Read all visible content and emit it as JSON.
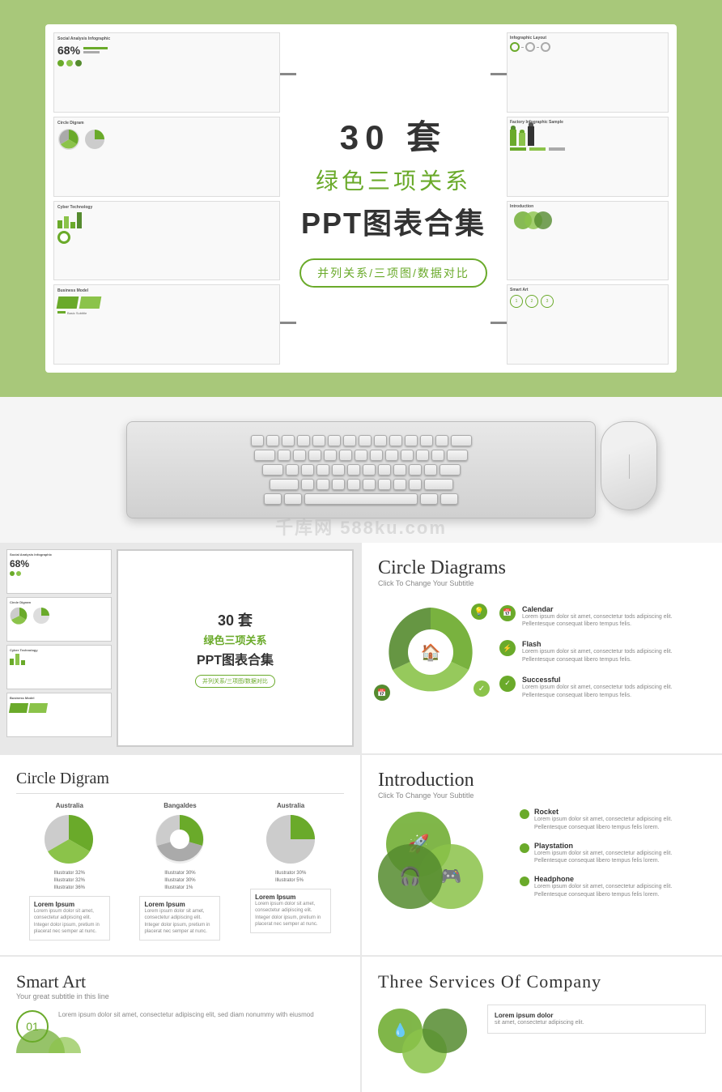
{
  "hero": {
    "title_num": "30 套",
    "title_zh": "绿色三项关系",
    "title_ppt": "PPT图表合集",
    "badge": "并列关系/三项图/数据对比",
    "frame_label": "center-frame"
  },
  "slides": {
    "slide1_label": "Social Analysis Infographic",
    "slide1_stat": "68%",
    "slide2_label": "Circle Digram",
    "slide3_label": "Cyber Technology",
    "slide4_label": "Business Model",
    "slide5_label": "Infographic Layout",
    "slide6_label": "Factory Infographic Sample",
    "slide7_label": "Introduction",
    "slide8_label": "Smart Art"
  },
  "circle_diagrams": {
    "title": "Circle Diagrams",
    "subtitle": "Click To Change Your Subtitle",
    "item1_title": "Calendar",
    "item1_desc": "Lorem ipsum dolor sit amet, consectetur tods adipiscing elit. Pellentesque consequat libero tempus felis.",
    "item2_title": "Flash",
    "item2_desc": "Lorem ipsum dolor sit amet, consectetur tods adipiscing elit. Pellentesque consequat libero tempus felis.",
    "item3_title": "Successful",
    "item3_desc": "Lorem ipsum dolor sit amet, consectetur tods adipiscing elit. Pellentesque consequat libero tempus felis."
  },
  "circle_digram": {
    "title": "Circle Digram",
    "country1": "Australia",
    "country2": "Bangaldes",
    "country3": "Australia",
    "legend1": [
      "Illustrator 32%",
      "Illustrator 32%",
      "Illustrator 36%"
    ],
    "legend2": [
      "Illustrator 30%",
      "Illustrator 30%",
      "Illustrator 1%"
    ],
    "legend3": [
      "Illustrator 30%",
      "Illustrator 5%"
    ],
    "box1_title": "Lorem Ipsum",
    "box1_desc": "Lorem ipsum dolor sit amet, consectetur adipiscing elit. Integer dolor ipsum, pretium in placerat nec semper at nunc.",
    "box2_title": "Lorem Ipsum",
    "box2_desc": "Lorem ipsum dolor sit amet, consectetur adipiscing elit. Integer dolor ipsum, pretium in placerat nec semper at nunc.",
    "box3_title": "Lorem Ipsum",
    "box3_desc": "Lorem ipsum dolor sit amet, consectetur adipiscing elit. Integer dolor ipsum, pretium in placerat nec semper at nunc."
  },
  "introduction": {
    "title": "Introduction",
    "subtitle": "Click To Change Your Subtitle",
    "item1_title": "Rocket",
    "item1_desc": "Lorem ipsum dolor sit amet, consectetur adipiscing elit. Pellentesque consequat libero tempus felis lorem.",
    "item2_title": "Playstation",
    "item2_desc": "Lorem ipsum dolor sit amet, consectetur adipiscing elit. Pellentesque consequat libero tempus felis lorem.",
    "item3_title": "Headphone",
    "item3_desc": "Lorem ipsum dolor sit amet, consectetur adipiscing elit. Pellentesque consequat libero tempus felis lorem."
  },
  "smart_art": {
    "title": "Smart Art",
    "subtitle": "Your great subtitle in this line",
    "item1_num": "01",
    "item1_desc": "Lorem ipsum dolor sit amet, consectetur adipiscing elit, sed diam nonummy with eiusmod"
  },
  "three_services": {
    "title": "Three Services Of Company",
    "box_title": "Lorem ipsum dolor",
    "box_desc": "sit amet, consectetur adipiscing elit."
  },
  "watermark": {
    "line1": "千库网",
    "line2": "588ku.com"
  },
  "colors": {
    "green": "#6aaa2a",
    "light_green_bg": "#a8c87a",
    "dark_green": "#3d6b1a",
    "text_dark": "#333333",
    "text_gray": "#888888"
  }
}
